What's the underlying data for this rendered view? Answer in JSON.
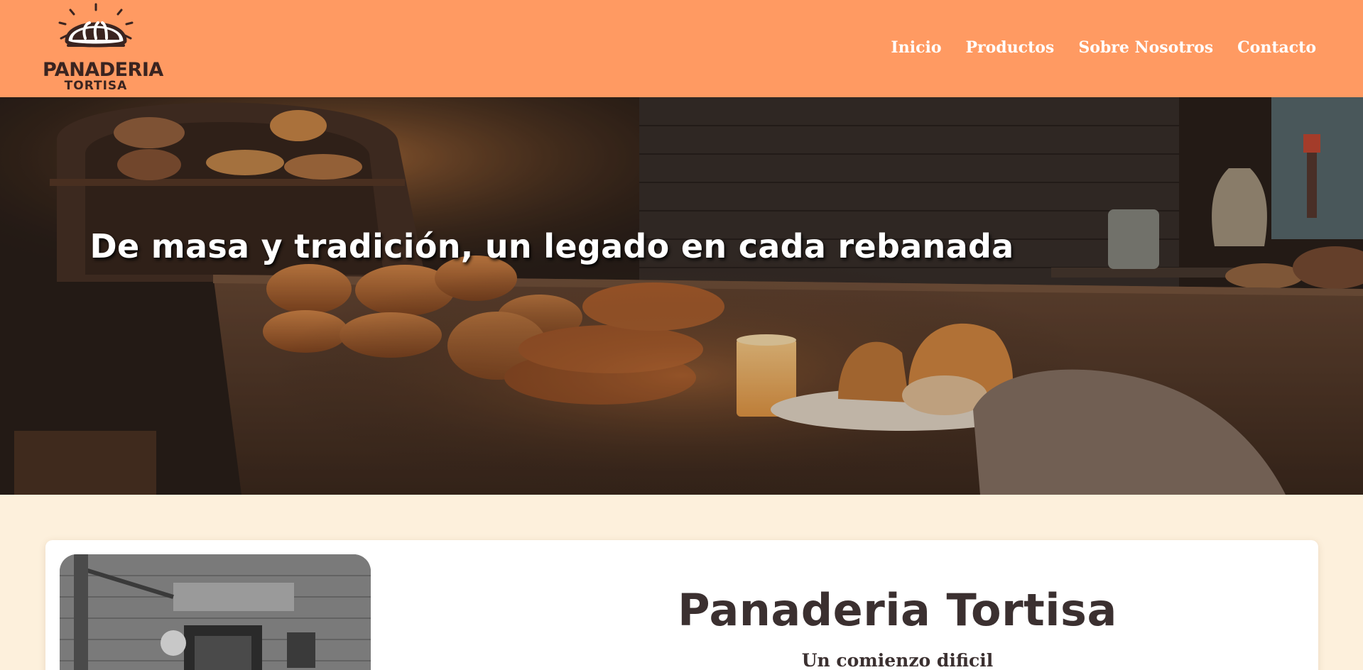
{
  "brand": {
    "name": "PANADERIA",
    "sub": "TORTISA"
  },
  "nav": {
    "items": [
      {
        "label": "Inicio"
      },
      {
        "label": "Productos"
      },
      {
        "label": "Sobre Nosotros"
      },
      {
        "label": "Contacto"
      }
    ]
  },
  "hero": {
    "title": "De masa y tradición, un legado en cada rebanada"
  },
  "about": {
    "title": "Panaderia Tortisa",
    "subtitle": "Un comienzo dificil"
  },
  "colors": {
    "header_bg": "#ff9a62",
    "page_bg": "#fdf0dc",
    "text_dark": "#3b3030"
  }
}
